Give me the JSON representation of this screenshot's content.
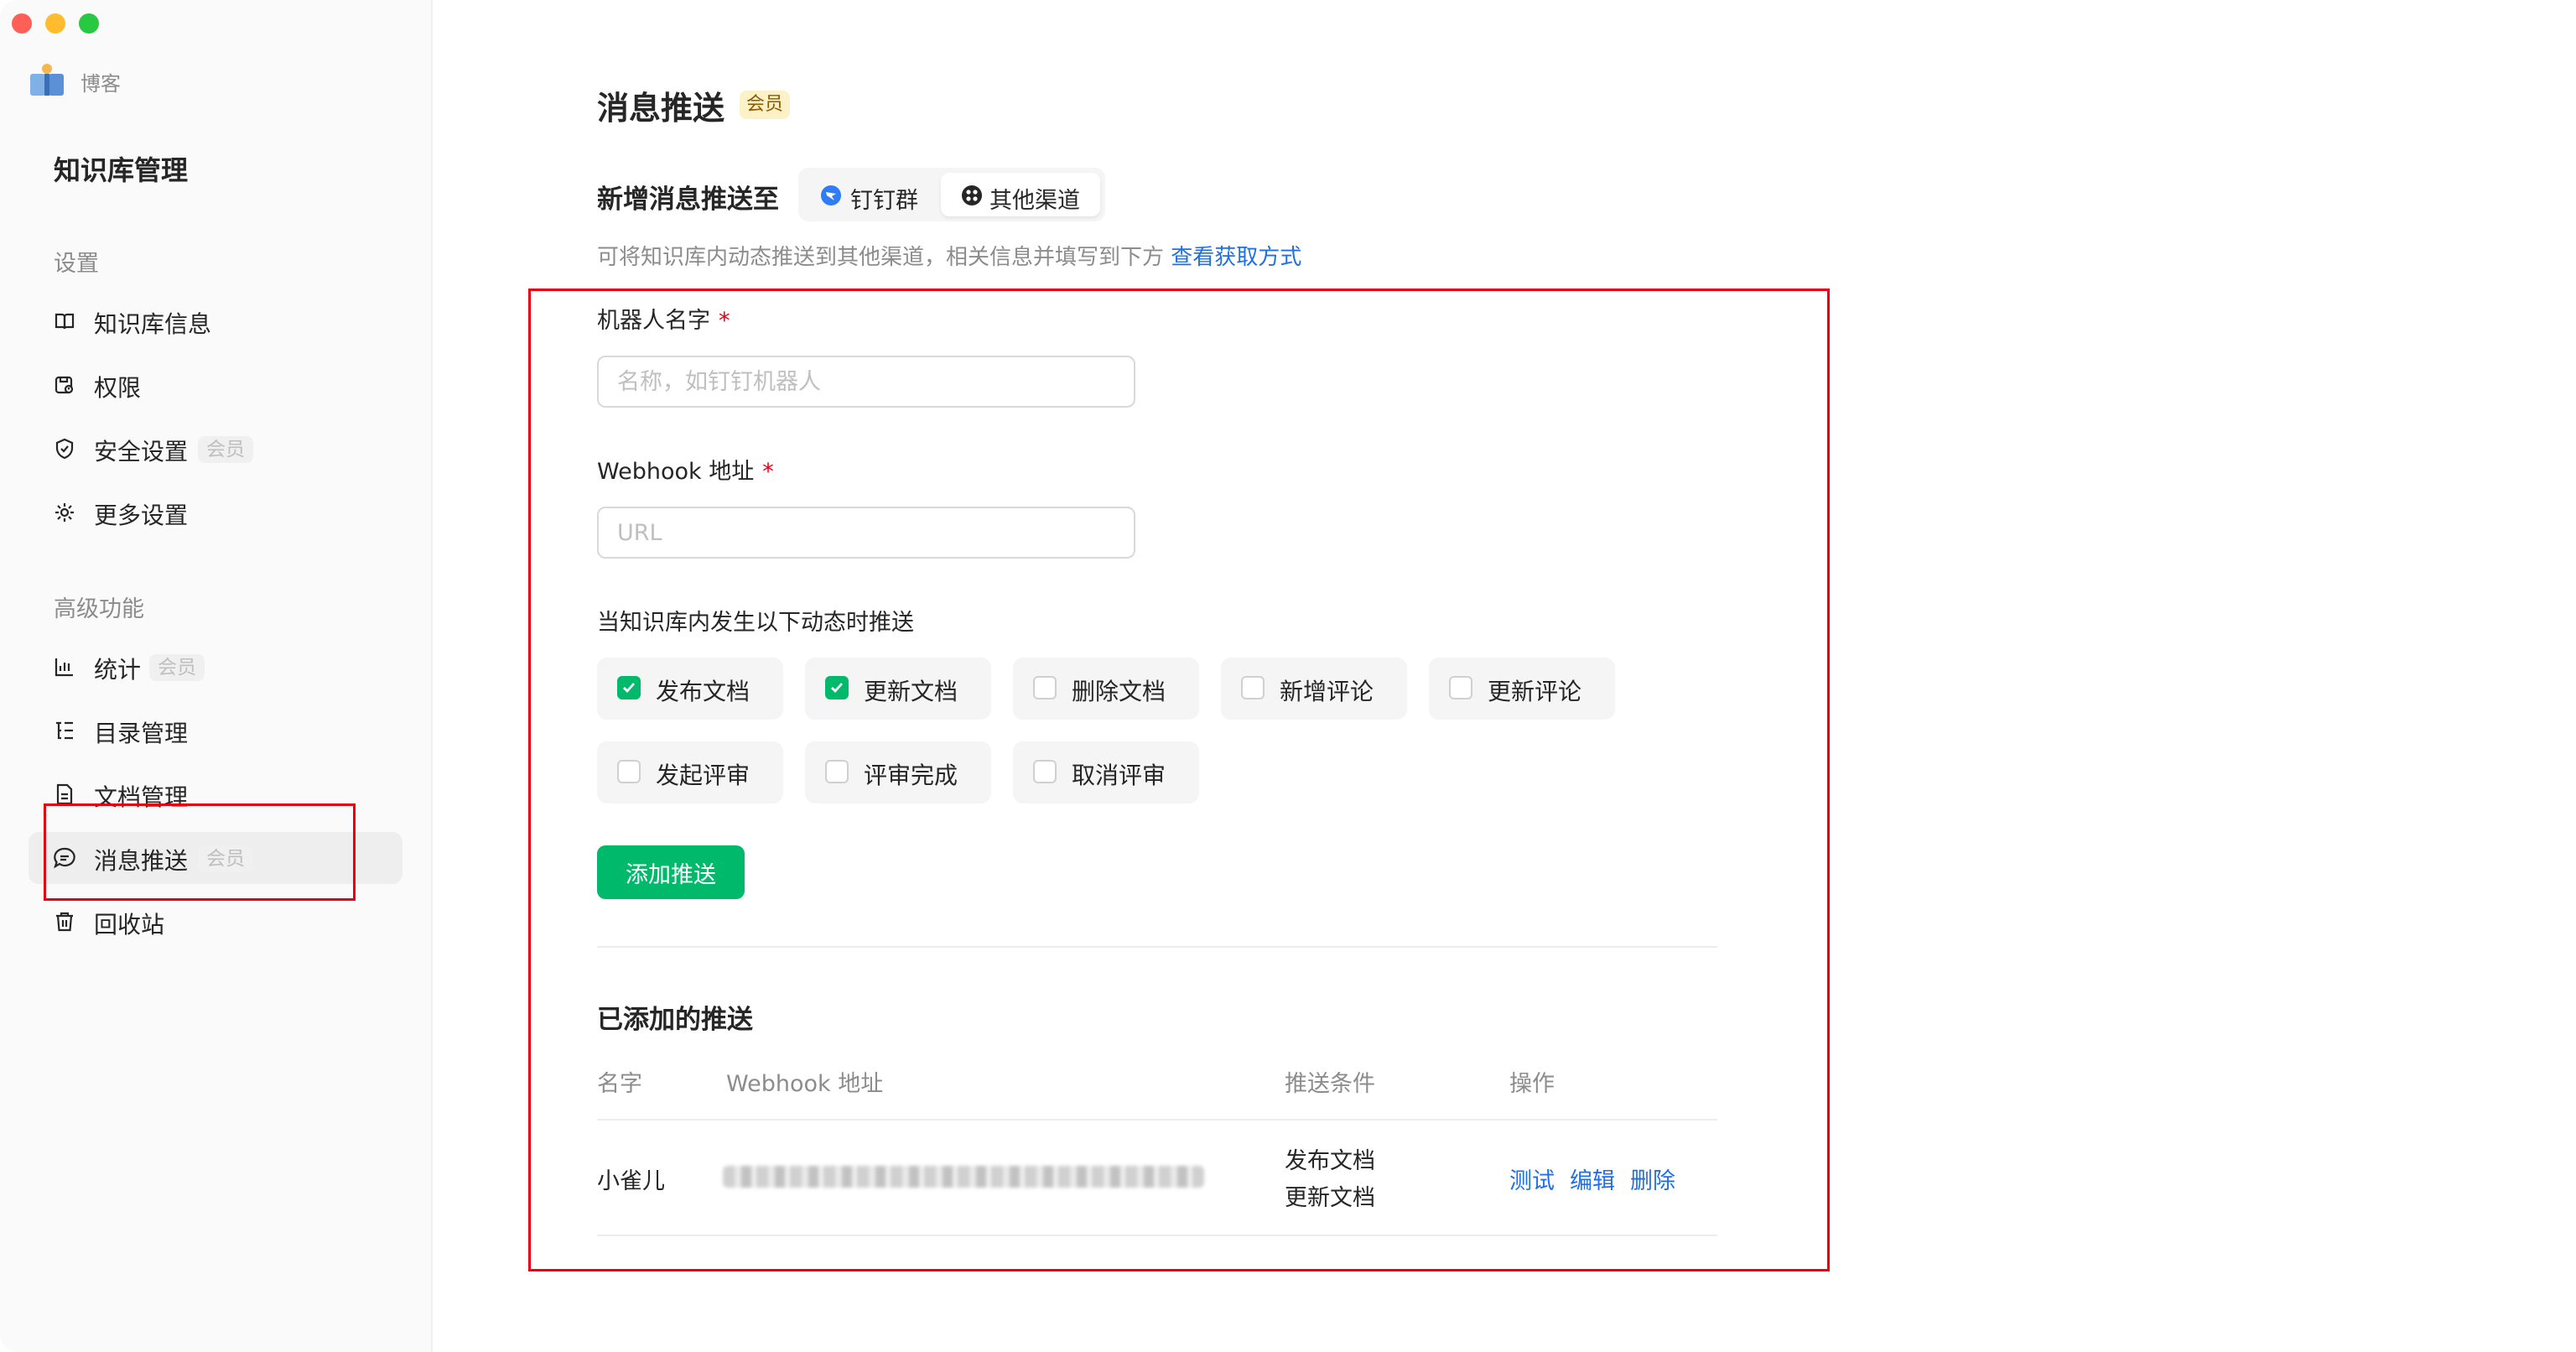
{
  "sidebar": {
    "kb_name": "博客",
    "title": "知识库管理",
    "groups": [
      {
        "label": "设置",
        "items": [
          {
            "label": "知识库信息",
            "icon": "book-icon"
          },
          {
            "label": "权限",
            "icon": "permission-lock-icon"
          },
          {
            "label": "安全设置",
            "icon": "shield-icon",
            "badge": "会员"
          },
          {
            "label": "更多设置",
            "icon": "gear-icon"
          }
        ]
      },
      {
        "label": "高级功能",
        "items": [
          {
            "label": "统计",
            "icon": "bar-chart-icon",
            "badge": "会员"
          },
          {
            "label": "目录管理",
            "icon": "outline-list-icon"
          },
          {
            "label": "文档管理",
            "icon": "document-icon"
          },
          {
            "label": "消息推送",
            "icon": "chat-bubble-icon",
            "badge": "会员",
            "active": true
          },
          {
            "label": "回收站",
            "icon": "trash-icon"
          }
        ]
      }
    ]
  },
  "main": {
    "title": "消息推送",
    "title_badge": "会员",
    "add_to_label": "新增消息推送至",
    "channels": [
      {
        "label": "钉钉群",
        "icon": "dingtalk-icon",
        "selected": false
      },
      {
        "label": "其他渠道",
        "icon": "grid-dots-icon",
        "selected": true
      }
    ],
    "hint": "可将知识库内动态推送到其他渠道，相关信息并填写到下方",
    "hint_link": "查看获取方式",
    "form": {
      "robot_name_label": "机器人名字",
      "robot_name_placeholder": "名称，如钉钉机器人",
      "robot_name_value": "",
      "webhook_label": "Webhook 地址",
      "webhook_placeholder": "URL",
      "webhook_value": "",
      "required_mark": "*",
      "events_label": "当知识库内发生以下动态时推送",
      "events": [
        {
          "label": "发布文档",
          "checked": true
        },
        {
          "label": "更新文档",
          "checked": true
        },
        {
          "label": "删除文档",
          "checked": false
        },
        {
          "label": "新增评论",
          "checked": false
        },
        {
          "label": "更新评论",
          "checked": false
        },
        {
          "label": "发起评审",
          "checked": false
        },
        {
          "label": "评审完成",
          "checked": false
        },
        {
          "label": "取消评审",
          "checked": false
        }
      ],
      "submit_label": "添加推送"
    },
    "added": {
      "title": "已添加的推送",
      "columns": [
        "名字",
        "Webhook 地址",
        "推送条件",
        "操作"
      ],
      "rows": [
        {
          "name": "小雀儿",
          "conditions": [
            "发布文档",
            "更新文档"
          ],
          "actions": [
            "测试",
            "编辑",
            "删除"
          ]
        }
      ]
    }
  },
  "colors": {
    "accent_green": "#00b96b",
    "link_blue": "#1f6fe8",
    "annotation_red": "#e60012",
    "badge_gold_bg": "#fdf1c8"
  }
}
